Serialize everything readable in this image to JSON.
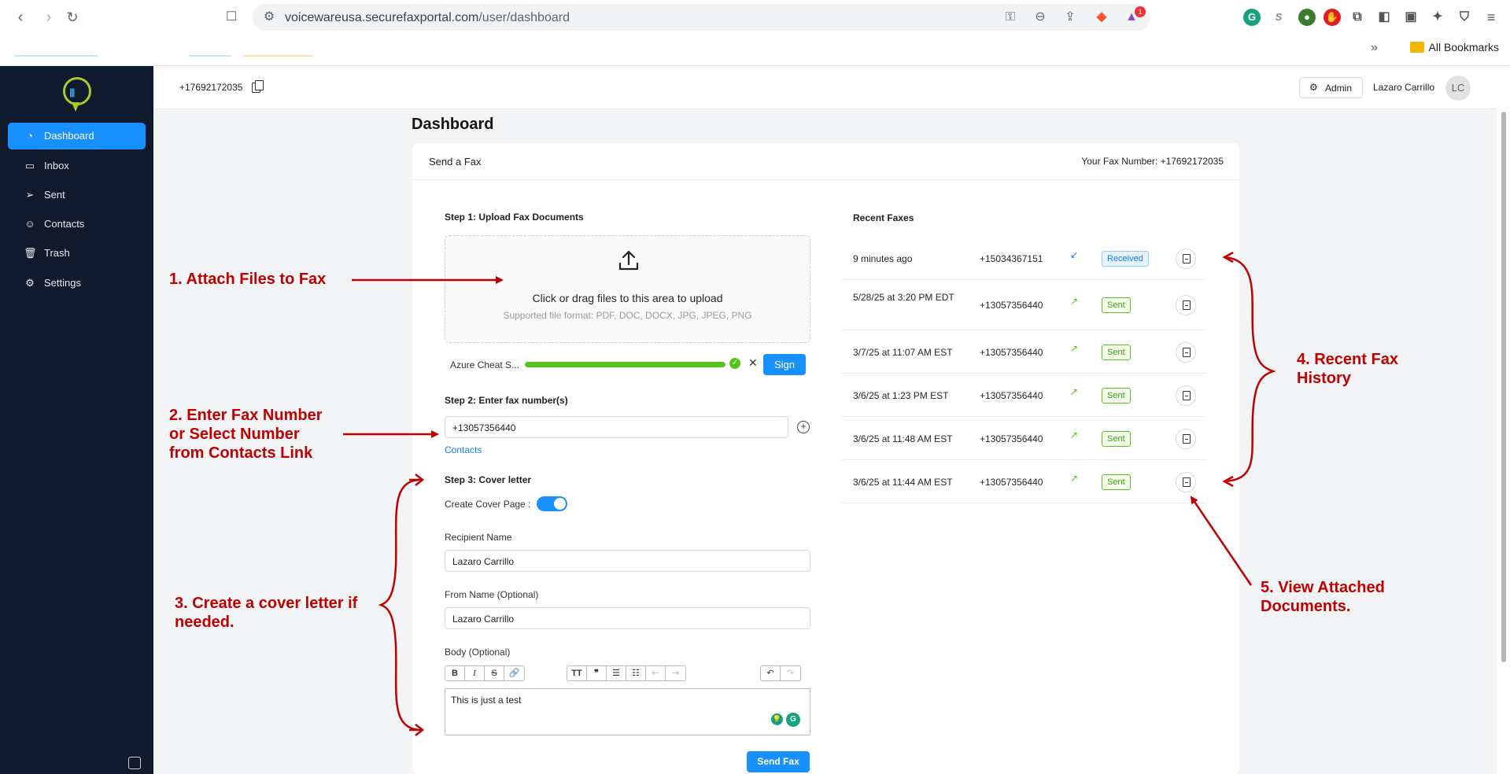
{
  "browser": {
    "url_host": "voicewareusa.securefaxportal.com",
    "url_path": "/user/dashboard",
    "bookmarks_label": "All Bookmarks",
    "brave_badge": "1",
    "overflow_label": "»"
  },
  "sidebar": {
    "items": [
      {
        "label": "Dashboard",
        "icon": "gauge-icon"
      },
      {
        "label": "Inbox",
        "icon": "inbox-icon"
      },
      {
        "label": "Sent",
        "icon": "send-icon"
      },
      {
        "label": "Contacts",
        "icon": "users-icon"
      },
      {
        "label": "Trash",
        "icon": "trash-icon"
      },
      {
        "label": "Settings",
        "icon": "gear-icon"
      }
    ]
  },
  "header": {
    "fax_number": "+17692172035",
    "admin_label": "Admin",
    "user_name": "Lazaro Carrillo",
    "avatar_initials": "LC"
  },
  "page": {
    "title": "Dashboard"
  },
  "card": {
    "title": "Send a Fax",
    "your_fax_number": "Your Fax Number: +17692172035"
  },
  "step1": {
    "title": "Step 1: Upload Fax Documents",
    "upload_main": "Click or drag files to this area to upload",
    "upload_sub": "Supported file format: PDF, DOC, DOCX, JPG, JPEG, PNG",
    "file_name": "Azure Cheat S...",
    "progress": 1.0,
    "sign_label": "Sign"
  },
  "step2": {
    "title": "Step 2: Enter fax number(s)",
    "fax_value": "+13057356440",
    "contacts_link": "Contacts"
  },
  "step3": {
    "title": "Step 3: Cover letter",
    "create_cover_label": "Create Cover Page :",
    "cover_enabled": true,
    "recipient_label": "Recipient Name",
    "recipient_value": "Lazaro Carrillo",
    "from_label": "From Name (Optional)",
    "from_value": "Lazaro Carrillo",
    "body_label": "Body (Optional)",
    "body_value": "This is just a test",
    "send_label": "Send Fax"
  },
  "recent": {
    "title": "Recent Faxes",
    "rows": [
      {
        "date": "9 minutes ago",
        "number": "+15034367151",
        "direction": "in",
        "status": "Received"
      },
      {
        "date": "5/28/25 at 3:20 PM EDT",
        "number": "+13057356440",
        "direction": "out",
        "status": "Sent"
      },
      {
        "date": "3/7/25 at 11:07 AM EST",
        "number": "+13057356440",
        "direction": "out",
        "status": "Sent"
      },
      {
        "date": "3/6/25 at 1:23 PM EST",
        "number": "+13057356440",
        "direction": "out",
        "status": "Sent"
      },
      {
        "date": "3/6/25 at 11:48 AM EST",
        "number": "+13057356440",
        "direction": "out",
        "status": "Sent"
      },
      {
        "date": "3/6/25 at 11:44 AM EST",
        "number": "+13057356440",
        "direction": "out",
        "status": "Sent"
      }
    ]
  },
  "annotations": {
    "a1": "1. Attach Files to Fax",
    "a2_l1": "2. Enter Fax Number",
    "a2_l2": "or Select Number",
    "a2_l3": "from Contacts Link",
    "a3_l1": "3. Create a cover letter if",
    "a3_l2": "needed.",
    "a4_l1": "4. Recent Fax",
    "a4_l2": "History",
    "a5_l1": "5. View Attached",
    "a5_l2": "Documents.",
    "color": "#c00000"
  },
  "colors": {
    "sidebar_bg": "#0f1b2d",
    "primary": "#1890ff",
    "success": "#52c41a"
  }
}
